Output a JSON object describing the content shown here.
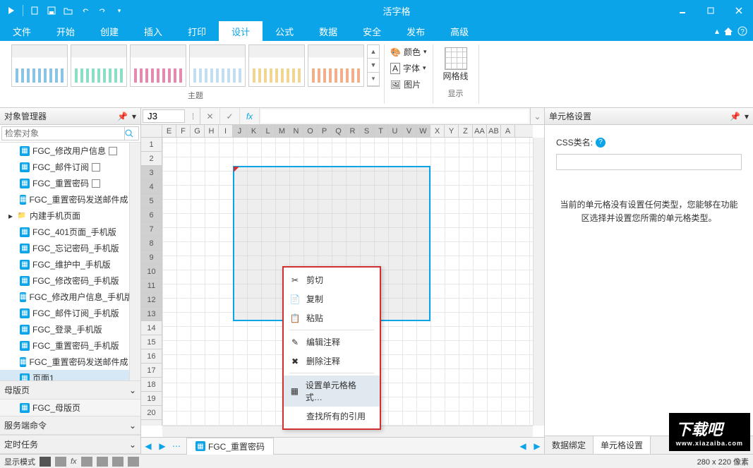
{
  "app": {
    "title": "活字格"
  },
  "qat_icons": [
    "play",
    "new",
    "save",
    "open",
    "undo",
    "redo"
  ],
  "tabs": [
    "文件",
    "开始",
    "创建",
    "插入",
    "打印",
    "设计",
    "公式",
    "数据",
    "安全",
    "发布",
    "高级"
  ],
  "active_tab": "设计",
  "ribbon": {
    "theme_group": "主题",
    "style_btns": {
      "color": "颜色",
      "font": "字体",
      "image": "图片"
    },
    "show_group": "显示",
    "grid_btn": "网格线"
  },
  "left": {
    "title": "对象管理器",
    "search_placeholder": "检索对象",
    "tree": [
      {
        "label": "FGC_修改用户信息",
        "type": "page",
        "sub": true
      },
      {
        "label": "FGC_邮件订阅",
        "type": "page",
        "sub": true
      },
      {
        "label": "FGC_重置密码",
        "type": "page",
        "sub": true
      },
      {
        "label": "FGC_重置密码发送邮件成",
        "type": "page"
      },
      {
        "label": "内建手机页面",
        "type": "folder"
      },
      {
        "label": "FGC_401页面_手机版",
        "type": "page"
      },
      {
        "label": "FGC_忘记密码_手机版",
        "type": "page"
      },
      {
        "label": "FGC_维护中_手机版",
        "type": "page"
      },
      {
        "label": "FGC_修改密码_手机版",
        "type": "page"
      },
      {
        "label": "FGC_修改用户信息_手机版",
        "type": "page"
      },
      {
        "label": "FGC_邮件订阅_手机版",
        "type": "page"
      },
      {
        "label": "FGC_登录_手机版",
        "type": "page"
      },
      {
        "label": "FGC_重置密码_手机版",
        "type": "page"
      },
      {
        "label": "FGC_重置密码发送邮件成",
        "type": "page"
      },
      {
        "label": "页面1",
        "type": "page",
        "selected": true
      }
    ],
    "sections": {
      "master": "母版页",
      "master_item": "FGC_母版页",
      "server": "服务端命令",
      "timer": "定时任务"
    }
  },
  "formula": {
    "cell": "J3",
    "fx": "fx"
  },
  "columns": [
    "E",
    "F",
    "G",
    "H",
    "I",
    "J",
    "K",
    "L",
    "M",
    "N",
    "O",
    "P",
    "Q",
    "R",
    "S",
    "T",
    "U",
    "V",
    "W",
    "X",
    "Y",
    "Z",
    "AA",
    "AB",
    "A"
  ],
  "rows": [
    "1",
    "2",
    "3",
    "4",
    "5",
    "6",
    "7",
    "8",
    "9",
    "10",
    "11",
    "12",
    "13",
    "14",
    "15",
    "16",
    "17",
    "18",
    "19",
    "20"
  ],
  "sel_cols_from": 5,
  "sel_cols_to": 18,
  "sel_rows_from": 2,
  "sel_rows_to": 12,
  "context_menu": {
    "items": [
      {
        "icon": "cut",
        "label": "剪切"
      },
      {
        "icon": "copy",
        "label": "复制"
      },
      {
        "icon": "paste",
        "label": "粘贴"
      },
      {
        "sep": true
      },
      {
        "icon": "edit",
        "label": "编辑注释"
      },
      {
        "icon": "delete",
        "label": "删除注释"
      },
      {
        "sep": true
      },
      {
        "icon": "format",
        "label": "设置单元格格式…",
        "hl": true
      },
      {
        "icon": "",
        "label": "查找所有的引用"
      }
    ]
  },
  "sheet": {
    "name": "FGC_重置密码"
  },
  "right": {
    "title": "单元格设置",
    "css_label": "CSS类名:",
    "msg": "当前的单元格没有设置任何类型，您能够在功能区选择并设置您所需的单元格类型。",
    "tabs": [
      "数据绑定",
      "单元格设置"
    ]
  },
  "status": {
    "mode": "显示模式",
    "dims": "280 x 220 像素"
  },
  "watermark": {
    "big": "下载吧",
    "small": "www.xiazaiba.com"
  }
}
